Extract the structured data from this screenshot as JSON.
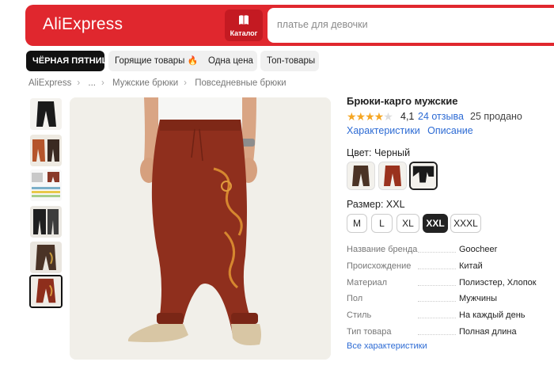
{
  "header": {
    "logo": "AliExpress",
    "catalog_label": "Каталог",
    "search_placeholder": "платье для девочки",
    "brand_color": "#e0272e"
  },
  "chips": [
    {
      "label": "ЧЁРНАЯ ПЯТНИЦА"
    },
    {
      "label": "Горящие товары",
      "icon": "fire-icon"
    },
    {
      "label": "Одна цена"
    },
    {
      "label": "Топ-товары"
    }
  ],
  "breadcrumbs": [
    "AliExpress",
    "...",
    "Мужские брюки",
    "Повседневные брюки"
  ],
  "gallery": {
    "thumbnails": [
      "black-pants",
      "orange-pants",
      "size-chart",
      "black-pants-2",
      "brown-pants",
      "red-pants"
    ],
    "selected_index": 5
  },
  "product": {
    "title": "Брюки-карго мужские",
    "rating": "4,1",
    "stars_filled": 4,
    "reviews": "24 отзыва",
    "sold": "25 продано",
    "links": [
      "Характеристики",
      "Описание"
    ],
    "color_label": "Цвет: Черный",
    "color_swatches": [
      "brown",
      "red",
      "black"
    ],
    "color_selected_index": 2,
    "size_label": "Размер: XXL",
    "sizes": [
      "M",
      "L",
      "XL",
      "XXL",
      "XXXL"
    ],
    "size_selected_index": 3,
    "specs": [
      {
        "key": "Название бренда",
        "value": "Goocheer"
      },
      {
        "key": "Происхождение",
        "value": "Китай"
      },
      {
        "key": "Материал",
        "value": "Полиэстер, Хлопок"
      },
      {
        "key": "Пол",
        "value": "Мужчины"
      },
      {
        "key": "Стиль",
        "value": "На каждый день"
      },
      {
        "key": "Тип товара",
        "value": "Полная длина"
      }
    ],
    "all_specs_link": "Все характеристики"
  }
}
